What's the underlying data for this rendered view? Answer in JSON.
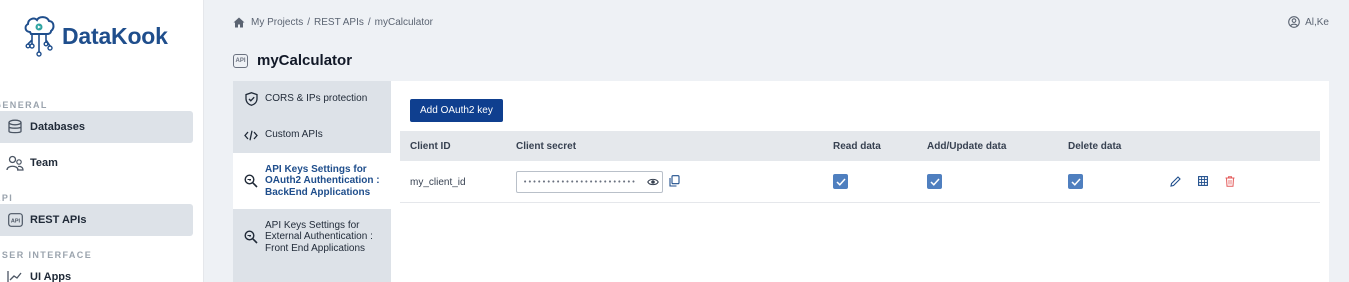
{
  "app": {
    "name": "DataKook"
  },
  "sidebar": {
    "sections": [
      {
        "label": "GENERAL"
      },
      {
        "label": "API"
      },
      {
        "label": "USER INTERFACE"
      }
    ],
    "items": [
      {
        "label": "Databases",
        "icon": "database-icon"
      },
      {
        "label": "Team",
        "icon": "team-icon"
      },
      {
        "label": "REST APIs",
        "icon": "api-icon"
      },
      {
        "label": "UI Apps",
        "icon": "chart-icon"
      }
    ]
  },
  "breadcrumb": {
    "items": [
      "My Projects",
      "REST APIs",
      "myCalculator"
    ],
    "separator": "/"
  },
  "user": {
    "name": "Al,Ke"
  },
  "page": {
    "title": "myCalculator",
    "badge": "API"
  },
  "settings_menu": {
    "items": [
      {
        "label": "CORS & IPs protection",
        "icon": "shield-icon"
      },
      {
        "label": "Custom APIs",
        "icon": "code-icon"
      },
      {
        "label": "API Keys Settings for OAuth2 Authentication : BackEnd Applications",
        "icon": "key-search-icon",
        "active": true
      },
      {
        "label": "API Keys Settings for External Authentication : Front End Applications",
        "icon": "key-search-icon"
      }
    ]
  },
  "content": {
    "add_button": "Add OAuth2 key",
    "columns": [
      "Client ID",
      "Client secret",
      "Read data",
      "Add/Update data",
      "Delete data"
    ],
    "rows": [
      {
        "client_id": "my_client_id",
        "client_secret_masked": "••••••••••••••••••••••••",
        "read": true,
        "add_update": true,
        "delete": true
      }
    ]
  },
  "colors": {
    "brand": "#1f4e8c",
    "button": "#0f3f8f",
    "checkbox": "#4f7fbf",
    "delete": "#e45b5b"
  }
}
